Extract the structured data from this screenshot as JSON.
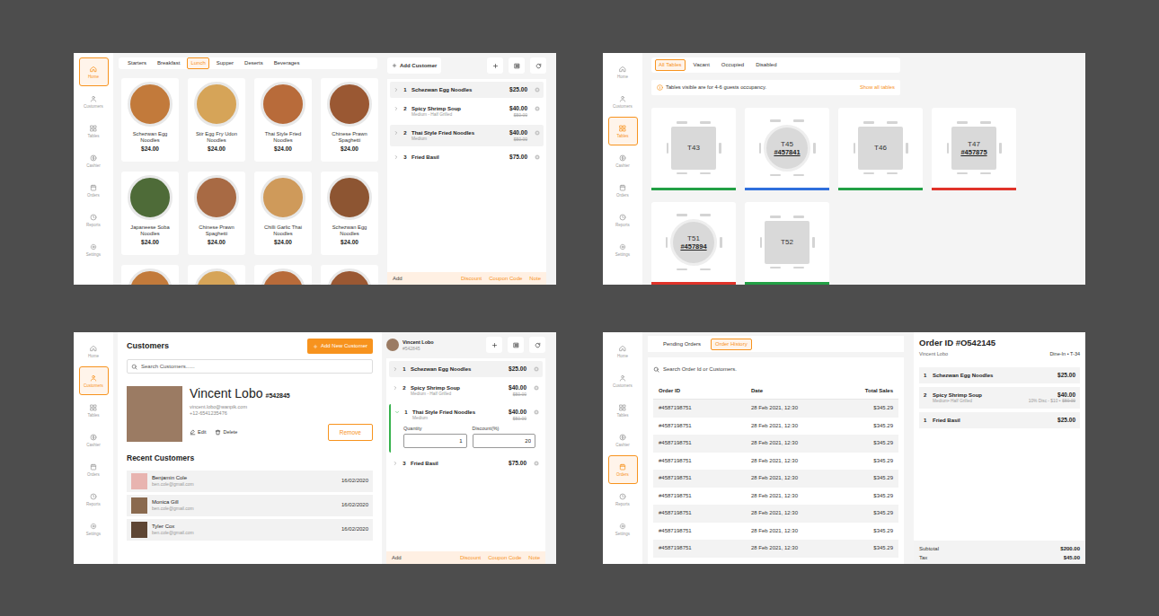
{
  "menu_screen": {
    "sidebar": [
      {
        "label": "Home",
        "selected": true
      },
      {
        "label": "Customers",
        "selected": false
      },
      {
        "label": "Tables",
        "selected": false
      },
      {
        "label": "Cashier",
        "selected": false
      },
      {
        "label": "Orders",
        "selected": false
      },
      {
        "label": "Reports",
        "selected": false
      },
      {
        "label": "Settings",
        "selected": false
      }
    ],
    "categories": [
      {
        "label": "Starters",
        "selected": false
      },
      {
        "label": "Breakfast",
        "selected": false
      },
      {
        "label": "Lunch",
        "selected": true
      },
      {
        "label": "Supper",
        "selected": false
      },
      {
        "label": "Deserts",
        "selected": false
      },
      {
        "label": "Beverages",
        "selected": false
      }
    ],
    "dishes": [
      {
        "name": "Schezwan Egg Noodles",
        "price": "$24.00"
      },
      {
        "name": "Stir Egg Fry Udon Noodles",
        "price": "$24.00"
      },
      {
        "name": "Thai Style Fried Noodles",
        "price": "$24.00"
      },
      {
        "name": "Chinese Prawn Spaghetti",
        "price": "$24.00"
      },
      {
        "name": "Japaneese Soba Noodles",
        "price": "$24.00"
      },
      {
        "name": "Chinese Prawn Spaghetti",
        "price": "$24.00"
      },
      {
        "name": "Chilli Garlic Thai Noodles",
        "price": "$24.00"
      },
      {
        "name": "Schezwan Egg Noodles",
        "price": "$24.00"
      },
      {
        "name": "",
        "price": ""
      },
      {
        "name": "",
        "price": ""
      },
      {
        "name": "",
        "price": ""
      },
      {
        "name": "",
        "price": ""
      }
    ],
    "order": {
      "add_customer": "Add Customer",
      "lines": [
        {
          "qty": "1",
          "name": "Schezwan Egg Noodles",
          "price": "$25.00",
          "note": "",
          "old_price": "",
          "expanded": false
        },
        {
          "qty": "2",
          "name": "Spicy Shrimp Soup",
          "price": "$40.00",
          "note": "Medium - Half Grilled",
          "old_price": "$50.00",
          "expanded": false
        },
        {
          "qty": "2",
          "name": "Thai Style Fried Noodles",
          "price": "$40.00",
          "note": "Medium",
          "old_price": "$50.00",
          "expanded": false
        },
        {
          "qty": "3",
          "name": "Fried Basil",
          "price": "$75.00",
          "note": "",
          "old_price": "",
          "expanded": false
        }
      ],
      "footer": {
        "add": "Add",
        "actions": [
          "Discount",
          "Coupon Code",
          "Note"
        ]
      }
    }
  },
  "tables_screen": {
    "sidebar": [
      {
        "label": "Home",
        "selected": false
      },
      {
        "label": "Customers",
        "selected": false
      },
      {
        "label": "Tables",
        "selected": true
      },
      {
        "label": "Cashier",
        "selected": false
      },
      {
        "label": "Orders",
        "selected": false
      },
      {
        "label": "Reports",
        "selected": false
      },
      {
        "label": "Settings",
        "selected": false
      }
    ],
    "filters": [
      {
        "label": "All Tables",
        "selected": true
      },
      {
        "label": "Vacant",
        "selected": false
      },
      {
        "label": "Occupied",
        "selected": false
      },
      {
        "label": "Disabled",
        "selected": false
      }
    ],
    "notice": "Tables visible are for 4-6 guests occupancy.",
    "notice_action": "Show all tables",
    "tables": [
      {
        "name": "T43",
        "order": "",
        "kind": "square",
        "color": "#22a045"
      },
      {
        "name": "T45",
        "order": "#457841",
        "kind": "round",
        "color": "#2f6fdc"
      },
      {
        "name": "T46",
        "order": "",
        "kind": "square",
        "color": "#22a045"
      },
      {
        "name": "T47",
        "order": "#457875",
        "kind": "square",
        "color": "#e0332a"
      },
      {
        "name": "T51",
        "order": "#457894",
        "kind": "round",
        "color": "#e0332a"
      },
      {
        "name": "T52",
        "order": "",
        "kind": "square",
        "color": "#22a045"
      }
    ]
  },
  "customers_screen": {
    "sidebar": [
      {
        "label": "Home",
        "selected": false
      },
      {
        "label": "Customers",
        "selected": true
      },
      {
        "label": "Tables",
        "selected": false
      },
      {
        "label": "Cashier",
        "selected": false
      },
      {
        "label": "Orders",
        "selected": false
      },
      {
        "label": "Reports",
        "selected": false
      },
      {
        "label": "Settings",
        "selected": false
      }
    ],
    "title": "Customers",
    "add_button": "Add New Customer",
    "search_placeholder": "Search Customers......",
    "customer": {
      "name": "Vincent Lobo",
      "id": "#542845",
      "email": "vincent.lobo@wanpik.com",
      "phone": "+12-6541235476",
      "edit": "Edit",
      "delete": "Delete",
      "remove": "Remove"
    },
    "recent_title": "Recent Customers",
    "recent": [
      {
        "name": "Benjamin Cole",
        "email": "ben.cole@gmail.com",
        "date": "16/02/2020"
      },
      {
        "name": "Monica Gill",
        "email": "ben.cole@gmail.com",
        "date": "16/02/2020"
      },
      {
        "name": "Tyler Cox",
        "email": "ben.cole@gmail.com",
        "date": "16/02/2020"
      }
    ],
    "order": {
      "customer_name": "Vincent Lobo",
      "customer_id": "#542845",
      "lines": [
        {
          "qty": "1",
          "name": "Schezwan Egg Noodles",
          "price": "$25.00",
          "note": "",
          "old_price": "",
          "expanded": false
        },
        {
          "qty": "2",
          "name": "Spicy Shrimp Soup",
          "price": "$40.00",
          "note": "Medium - Half Grilled",
          "old_price": "$50.00",
          "expanded": false
        },
        {
          "qty": "1",
          "name": "Thai Style Fried Noodles",
          "price": "$40.00",
          "note": "Medium",
          "old_price": "$50.00",
          "expanded": true,
          "quantity_label": "Quantity",
          "quantity": "1",
          "discount_label": "Discount(%)",
          "discount": "20"
        },
        {
          "qty": "3",
          "name": "Fried Basil",
          "price": "$75.00",
          "note": "",
          "old_price": "",
          "expanded": false
        }
      ],
      "footer": {
        "add": "Add",
        "actions": [
          "Discount",
          "Coupon Code",
          "Note"
        ]
      }
    }
  },
  "orders_screen": {
    "sidebar": [
      {
        "label": "Home",
        "selected": false
      },
      {
        "label": "Customers",
        "selected": false
      },
      {
        "label": "Tables",
        "selected": false
      },
      {
        "label": "Cashier",
        "selected": false
      },
      {
        "label": "Orders",
        "selected": true
      },
      {
        "label": "Reports",
        "selected": false
      },
      {
        "label": "Settings",
        "selected": false
      }
    ],
    "tabs": [
      {
        "label": "Pending Orders",
        "selected": false
      },
      {
        "label": "Order History",
        "selected": true
      }
    ],
    "search_placeholder": "Search Order Id or Customers.",
    "columns": [
      "Order ID",
      "Date",
      "Total Sales"
    ],
    "rows": [
      [
        "#4587198751",
        "28 Feb 2021, 12:30",
        "$345.29"
      ],
      [
        "#4587198751",
        "28 Feb 2021, 12:30",
        "$345.29"
      ],
      [
        "#4587198751",
        "28 Feb 2021, 12:30",
        "$345.29"
      ],
      [
        "#4587198751",
        "28 Feb 2021, 12:30",
        "$345.29"
      ],
      [
        "#4587198751",
        "28 Feb 2021, 12:30",
        "$345.29"
      ],
      [
        "#4587198751",
        "28 Feb 2021, 12:30",
        "$345.29"
      ],
      [
        "#4587198751",
        "28 Feb 2021, 12:30",
        "$345.29"
      ],
      [
        "#4587198751",
        "28 Feb 2021, 12:30",
        "$345.29"
      ],
      [
        "#4587198751",
        "28 Feb 2021, 12:30",
        "$345.29"
      ]
    ],
    "detail": {
      "title": "Order ID #O542145",
      "customer": "Vincent Lobo",
      "service": "Dine-In • T-34",
      "lines": [
        {
          "qty": "1",
          "name": "Schezwan Egg Noodles",
          "price": "$25.00",
          "note": "",
          "discount": "",
          "old_price": ""
        },
        {
          "qty": "2",
          "name": "Spicy Shrimp Soup",
          "price": "$40.00",
          "note": "Medium• Half Grilled",
          "discount": "10% Disc - $10 •",
          "old_price": "$50.00"
        },
        {
          "qty": "1",
          "name": "Fried Basil",
          "price": "$25.00",
          "note": "",
          "discount": "",
          "old_price": ""
        }
      ],
      "totals": [
        {
          "label": "Subtotal",
          "value": "$200.00"
        },
        {
          "label": "Tax",
          "value": "$45.00"
        }
      ]
    }
  }
}
